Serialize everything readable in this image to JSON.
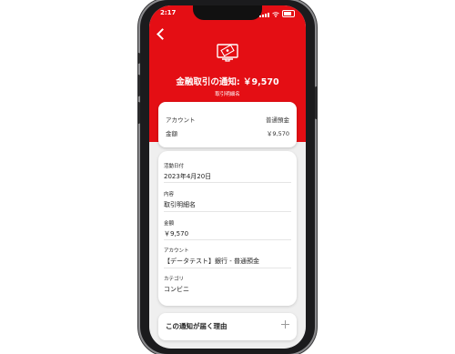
{
  "status": {
    "time": "2:17"
  },
  "header": {
    "title": "金融取引の通知: ￥9,570",
    "subtitle": "取引明細名",
    "icon": "banknote-hand-icon",
    "color": "#e40e14"
  },
  "summary": {
    "account_label": "アカウント",
    "account_value": "普通預金",
    "amount_label": "金額",
    "amount_value": "￥9,570"
  },
  "details": [
    {
      "label": "活動日付",
      "value": "2023年4月20日"
    },
    {
      "label": "内容",
      "value": "取引明細名"
    },
    {
      "label": "金額",
      "value": "￥9,570"
    },
    {
      "label": "アカウント",
      "value": "【データテスト】銀行 - 普通預金"
    },
    {
      "label": "カテゴリ",
      "value": "コンビニ"
    }
  ],
  "reason": {
    "label": "この通知が届く理由"
  }
}
